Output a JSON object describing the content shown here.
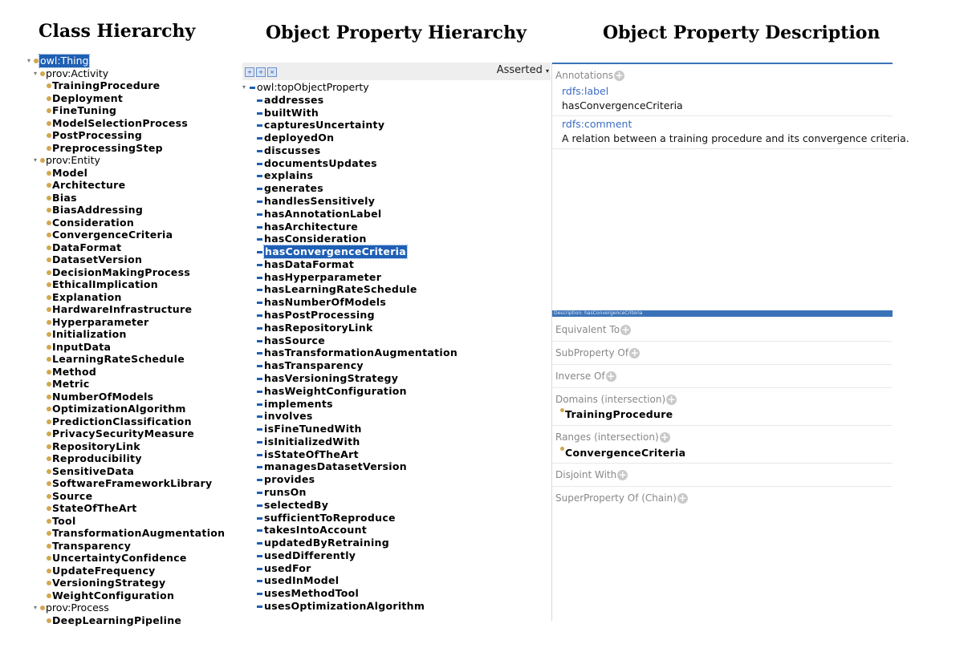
{
  "headings": {
    "class": "Class Hierarchy",
    "property": "Object Property Hierarchy",
    "description": "Object Property Description"
  },
  "class_tree": [
    {
      "label": "owl:Thing",
      "level": 0,
      "expanded": true,
      "selected": true
    },
    {
      "label": "prov:Activity",
      "level": 1,
      "expanded": true
    },
    {
      "label": "TrainingProcedure",
      "level": 2
    },
    {
      "label": "Deployment",
      "level": 2
    },
    {
      "label": "FineTuning",
      "level": 2
    },
    {
      "label": "ModelSelectionProcess",
      "level": 2
    },
    {
      "label": "PostProcessing",
      "level": 2
    },
    {
      "label": "PreprocessingStep",
      "level": 2
    },
    {
      "label": "prov:Entity",
      "level": 1,
      "expanded": true
    },
    {
      "label": "Model",
      "level": 2
    },
    {
      "label": "Architecture",
      "level": 2
    },
    {
      "label": "Bias",
      "level": 2
    },
    {
      "label": "BiasAddressing",
      "level": 2
    },
    {
      "label": "Consideration",
      "level": 2
    },
    {
      "label": "ConvergenceCriteria",
      "level": 2
    },
    {
      "label": "DataFormat",
      "level": 2
    },
    {
      "label": "DatasetVersion",
      "level": 2
    },
    {
      "label": "DecisionMakingProcess",
      "level": 2
    },
    {
      "label": "EthicalImplication",
      "level": 2
    },
    {
      "label": "Explanation",
      "level": 2
    },
    {
      "label": "HardwareInfrastructure",
      "level": 2
    },
    {
      "label": "Hyperparameter",
      "level": 2
    },
    {
      "label": "Initialization",
      "level": 2
    },
    {
      "label": "InputData",
      "level": 2
    },
    {
      "label": "LearningRateSchedule",
      "level": 2
    },
    {
      "label": "Method",
      "level": 2
    },
    {
      "label": "Metric",
      "level": 2
    },
    {
      "label": "NumberOfModels",
      "level": 2
    },
    {
      "label": "OptimizationAlgorithm",
      "level": 2
    },
    {
      "label": "PredictionClassification",
      "level": 2
    },
    {
      "label": "PrivacySecurityMeasure",
      "level": 2
    },
    {
      "label": "RepositoryLink",
      "level": 2
    },
    {
      "label": "Reproducibility",
      "level": 2
    },
    {
      "label": "SensitiveData",
      "level": 2
    },
    {
      "label": "SoftwareFrameworkLibrary",
      "level": 2
    },
    {
      "label": "Source",
      "level": 2
    },
    {
      "label": "StateOfTheArt",
      "level": 2
    },
    {
      "label": "Tool",
      "level": 2
    },
    {
      "label": "TransformationAugmentation",
      "level": 2
    },
    {
      "label": "Transparency",
      "level": 2
    },
    {
      "label": "UncertaintyConfidence",
      "level": 2
    },
    {
      "label": "UpdateFrequency",
      "level": 2
    },
    {
      "label": "VersioningStrategy",
      "level": 2
    },
    {
      "label": "WeightConfiguration",
      "level": 2
    },
    {
      "label": "prov:Process",
      "level": 1,
      "expanded": true
    },
    {
      "label": "DeepLearningPipeline",
      "level": 2
    }
  ],
  "property_toolbar": {
    "icons": [
      "add-sub-property-icon",
      "add-sibling-property-icon",
      "delete-property-icon"
    ],
    "mode": "Asserted"
  },
  "property_tree": [
    {
      "label": "owl:topObjectProperty",
      "level": 0,
      "expanded": true
    },
    {
      "label": "addresses",
      "level": 1
    },
    {
      "label": "builtWith",
      "level": 1
    },
    {
      "label": "capturesUncertainty",
      "level": 1
    },
    {
      "label": "deployedOn",
      "level": 1
    },
    {
      "label": "discusses",
      "level": 1
    },
    {
      "label": "documentsUpdates",
      "level": 1
    },
    {
      "label": "explains",
      "level": 1
    },
    {
      "label": "generates",
      "level": 1
    },
    {
      "label": "handlesSensitively",
      "level": 1
    },
    {
      "label": "hasAnnotationLabel",
      "level": 1
    },
    {
      "label": "hasArchitecture",
      "level": 1
    },
    {
      "label": "hasConsideration",
      "level": 1
    },
    {
      "label": "hasConvergenceCriteria",
      "level": 1,
      "selected": true
    },
    {
      "label": "hasDataFormat",
      "level": 1
    },
    {
      "label": "hasHyperparameter",
      "level": 1
    },
    {
      "label": "hasLearningRateSchedule",
      "level": 1
    },
    {
      "label": "hasNumberOfModels",
      "level": 1
    },
    {
      "label": "hasPostProcessing",
      "level": 1
    },
    {
      "label": "hasRepositoryLink",
      "level": 1
    },
    {
      "label": "hasSource",
      "level": 1
    },
    {
      "label": "hasTransformationAugmentation",
      "level": 1
    },
    {
      "label": "hasTransparency",
      "level": 1
    },
    {
      "label": "hasVersioningStrategy",
      "level": 1
    },
    {
      "label": "hasWeightConfiguration",
      "level": 1
    },
    {
      "label": "implements",
      "level": 1
    },
    {
      "label": "involves",
      "level": 1
    },
    {
      "label": "isFineTunedWith",
      "level": 1
    },
    {
      "label": "isInitializedWith",
      "level": 1
    },
    {
      "label": "isStateOfTheArt",
      "level": 1
    },
    {
      "label": "managesDatasetVersion",
      "level": 1
    },
    {
      "label": "provides",
      "level": 1
    },
    {
      "label": "runsOn",
      "level": 1
    },
    {
      "label": "selectedBy",
      "level": 1
    },
    {
      "label": "sufficientToReproduce",
      "level": 1
    },
    {
      "label": "takesIntoAccount",
      "level": 1
    },
    {
      "label": "updatedByRetraining",
      "level": 1
    },
    {
      "label": "usedDifferently",
      "level": 1
    },
    {
      "label": "usedFor",
      "level": 1
    },
    {
      "label": "usedInModel",
      "level": 1
    },
    {
      "label": "usesMethodTool",
      "level": 1
    },
    {
      "label": "usesOptimizationAlgorithm",
      "level": 1
    }
  ],
  "annotations": {
    "title": "Annotations",
    "label_key": "rdfs:label",
    "label_value": "hasConvergenceCriteria",
    "comment_key": "rdfs:comment",
    "comment_value": "A relation between a training procedure and its convergence criteria."
  },
  "description": {
    "bar_title": "Description: hasConvergenceCriteria",
    "equivalent_to": "Equivalent To",
    "subproperty_of": "SubProperty Of",
    "inverse_of": "Inverse Of",
    "domains": "Domains (intersection)",
    "domain_value": "TrainingProcedure",
    "ranges": "Ranges (intersection)",
    "range_value": "ConvergenceCriteria",
    "disjoint_with": "Disjoint With",
    "superproperty_chain": "SuperProperty Of (Chain)"
  }
}
